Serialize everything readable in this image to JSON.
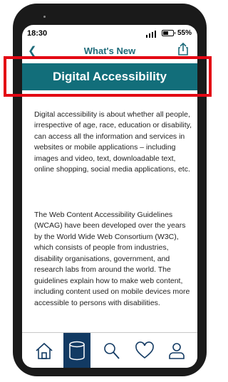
{
  "status": {
    "time": "18:30",
    "battery": "55%",
    "battery_level": 0.55
  },
  "nav": {
    "title": "What's New"
  },
  "banner": {
    "title": "Digital Accessibility"
  },
  "article": {
    "p1": "Digital accessibility is about whether all people, irrespective of age, race, education or disability, can access all the information and services in websites or mobile applications – including images and video, text, downloadable text, online shopping, social media applications, etc.",
    "p2": "The Web Content Accessibility Guidelines (WCAG) have been developed over the years by the World Wide Web Consortium (W3C), which consists of people from industries, disability organisations, government, and research labs from around the world. The guidelines explain how to make web content, including content used on mobile devices more accessible to persons with disabilities."
  },
  "tabs": [
    {
      "icon": "home-icon"
    },
    {
      "icon": "database-icon",
      "active": true
    },
    {
      "icon": "search-icon"
    },
    {
      "icon": "heart-icon"
    },
    {
      "icon": "user-icon"
    }
  ],
  "colors": {
    "accent": "#126e7a",
    "active_tab": "#123a63",
    "highlight": "#e30613"
  }
}
